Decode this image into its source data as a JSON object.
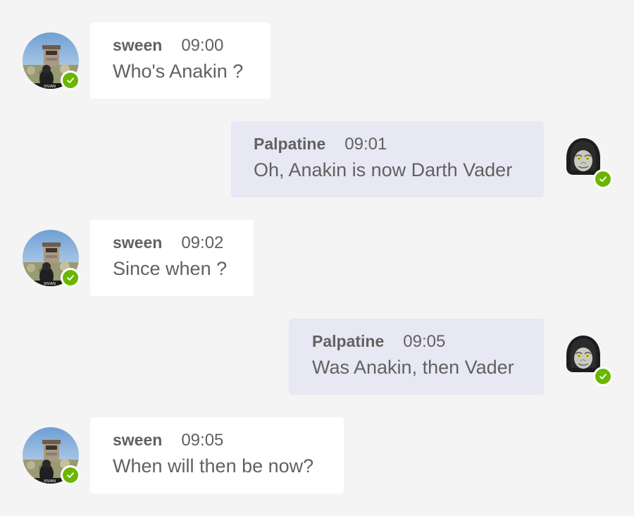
{
  "colors": {
    "background": "#f4f4f4",
    "incoming_bubble": "#ffffff",
    "outgoing_bubble": "#e8e8f4",
    "text": "#616161",
    "status_available": "#6bb700"
  },
  "messages": [
    {
      "author": "sween",
      "time": "09:00",
      "text": "Who's Anakin ?",
      "direction": "incoming",
      "avatar_icon": "watchtower-photo-avatar",
      "status_icon": "checkmark-icon"
    },
    {
      "author": "Palpatine",
      "time": "09:01",
      "text": "Oh, Anakin is now Darth Vader",
      "direction": "outgoing",
      "avatar_icon": "hooded-emperor-avatar",
      "status_icon": "checkmark-icon"
    },
    {
      "author": "sween",
      "time": "09:02",
      "text": "Since when ?",
      "direction": "incoming",
      "avatar_icon": "watchtower-photo-avatar",
      "status_icon": "checkmark-icon"
    },
    {
      "author": "Palpatine",
      "time": "09:05",
      "text": "Was Anakin, then Vader",
      "direction": "outgoing",
      "avatar_icon": "hooded-emperor-avatar",
      "status_icon": "checkmark-icon"
    },
    {
      "author": "sween",
      "time": "09:05",
      "text": "When will then be now?",
      "direction": "incoming",
      "avatar_icon": "watchtower-photo-avatar",
      "status_icon": "checkmark-icon"
    }
  ]
}
